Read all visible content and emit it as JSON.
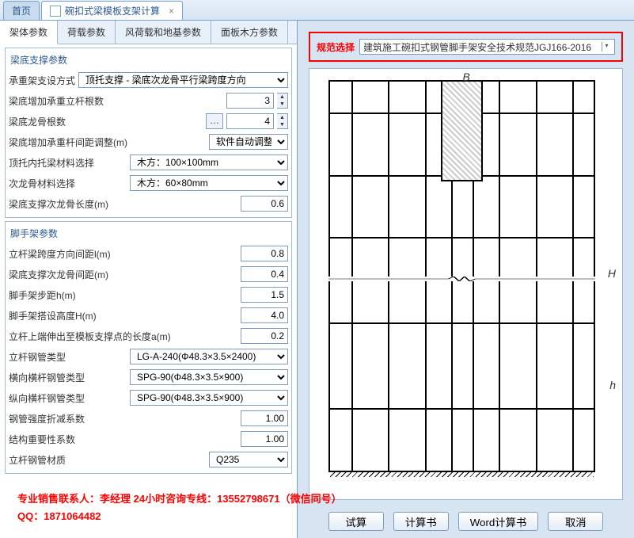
{
  "tabs": {
    "home": "首页",
    "doc": "碗扣式梁模板支架计算"
  },
  "subtabs": [
    "架体参数",
    "荷载参数",
    "风荷载和地基参数",
    "面板木方参数"
  ],
  "spec": {
    "label": "规范选择",
    "value": "建筑施工碗扣式钢管脚手架安全技术规范JGJ166-2016"
  },
  "group1": {
    "title": "梁底支撑参数",
    "r1": {
      "label": "承重架支设方式",
      "value": "顶托支撑 - 梁底次龙骨平行梁跨度方向"
    },
    "r2": {
      "label": "梁底增加承重立杆根数",
      "value": "3"
    },
    "r3": {
      "label": "梁底龙骨根数",
      "value": "4"
    },
    "r4": {
      "label": "梁底增加承重杆间距调整(m)",
      "value": "软件自动调整"
    },
    "r5": {
      "label": "顶托内托梁材料选择",
      "value": "木方：100×100mm"
    },
    "r6": {
      "label": "次龙骨材料选择",
      "value": "木方：60×80mm"
    },
    "r7": {
      "label": "梁底支撑次龙骨长度(m)",
      "value": "0.6"
    }
  },
  "group2": {
    "title": "脚手架参数",
    "r1": {
      "label": "立杆梁跨度方向间距l(m)",
      "value": "0.8"
    },
    "r2": {
      "label": "梁底支撑次龙骨间距(m)",
      "value": "0.4"
    },
    "r3": {
      "label": "脚手架步距h(m)",
      "value": "1.5"
    },
    "r4": {
      "label": "脚手架搭设高度H(m)",
      "value": "4.0"
    },
    "r5": {
      "label": "立杆上端伸出至模板支撑点的长度a(m)",
      "value": "0.2"
    },
    "r6": {
      "label": "立杆钢管类型",
      "value": "LG-A-240(Φ48.3×3.5×2400)"
    },
    "r7": {
      "label": "横向横杆钢管类型",
      "value": "SPG-90(Φ48.3×3.5×900)"
    },
    "r8": {
      "label": "纵向横杆钢管类型",
      "value": "SPG-90(Φ48.3×3.5×900)"
    },
    "r9": {
      "label": "钢管强度折减系数",
      "value": "1.00"
    },
    "r10": {
      "label": "结构重要性系数",
      "value": "1.00"
    },
    "r11": {
      "label": "立杆钢管材质",
      "value": "Q235"
    }
  },
  "diagram": {
    "B": "B",
    "H": "H",
    "h": "h"
  },
  "buttons": {
    "trial": "试算",
    "calc": "计算书",
    "word": "Word计算书",
    "cancel": "取消"
  },
  "footer": {
    "line1": "专业销售联系人：李经理  24小时咨询专线：13552798671（微信同号）",
    "line2": "QQ：1871064482"
  }
}
